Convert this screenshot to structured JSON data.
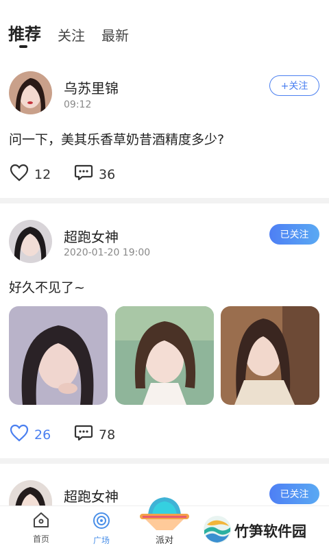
{
  "tabs": [
    {
      "label": "推荐",
      "active": true
    },
    {
      "label": "关注",
      "active": false
    },
    {
      "label": "最新",
      "active": false
    }
  ],
  "posts": [
    {
      "username": "乌苏里锦",
      "time": "09:12",
      "follow_label": "+关注",
      "text": "问一下，美其乐香草奶昔酒精度多少?",
      "likes": "12",
      "comments": "36",
      "liked": false
    },
    {
      "username": "超跑女神",
      "time": "2020-01-20 19:00",
      "follow_label": "已关注",
      "text": "好久不见了~",
      "likes": "26",
      "comments": "78",
      "liked": true
    },
    {
      "username": "超跑女神",
      "follow_label": "已关注"
    }
  ],
  "nav": {
    "home": "首页",
    "plaza": "广场",
    "party": "派对"
  },
  "watermark": "竹笋软件园",
  "colors": {
    "accent": "#4a7ff0",
    "divider": "#f2f2f2"
  }
}
